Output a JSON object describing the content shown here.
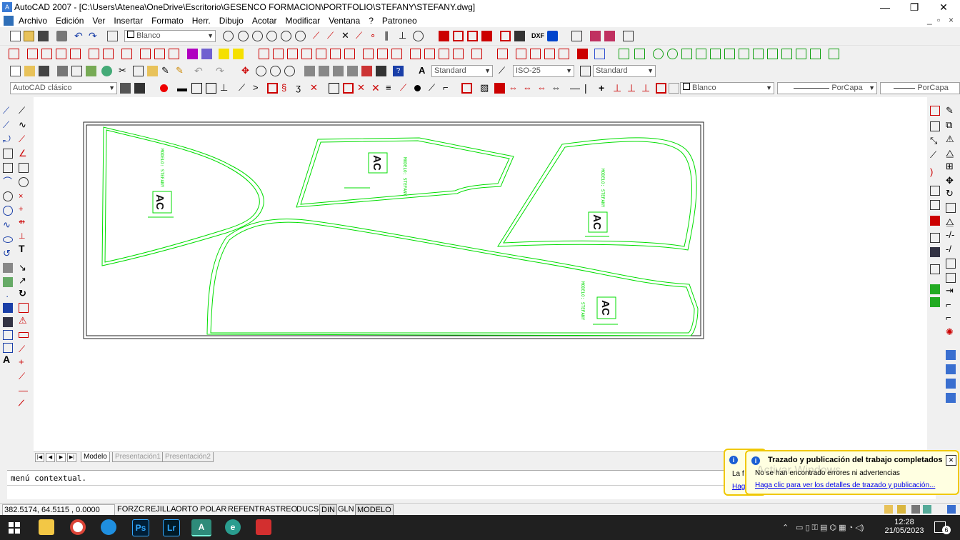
{
  "window": {
    "app_icon_label": "A",
    "title": "AutoCAD 2007 - [C:\\Users\\Atenea\\OneDrive\\Escritorio\\GESENCO FORMACION\\PORTFOLIO\\STEFANY\\STEFANY.dwg]",
    "minimize": "—",
    "maximize": "❐",
    "close": "✕"
  },
  "menubar": {
    "items": [
      "Archivo",
      "Edición",
      "Ver",
      "Insertar",
      "Formato",
      "Herr.",
      "Dibujo",
      "Acotar",
      "Modificar",
      "Ventana",
      "?",
      "Patroneo"
    ],
    "mdi_min": "_",
    "mdi_restore": "▫",
    "mdi_close": "×"
  },
  "toolbar1": {
    "layer_combo": "Blanco"
  },
  "toolbar3": {
    "text_style": "Standard",
    "dim_style": "ISO-25",
    "table_style": "Standard"
  },
  "toolbar4": {
    "workspace": "AutoCAD clásico",
    "color": "Blanco",
    "linetype": "PorCapa",
    "lineweight": "PorCapa"
  },
  "side_text_tool": "T",
  "side_mtext_tool": "A",
  "drawing": {
    "stroke_color": "#00dd00",
    "piece_labels": [
      "MODELO: STEFANY",
      "MODELO: STEFANY",
      "MODELO: STEFANY",
      "MODELO: STEFANY"
    ],
    "logo_text": "AC"
  },
  "tabs": {
    "nav": [
      "|◀",
      "◀",
      "▶",
      "▶|"
    ],
    "items": [
      "Modelo",
      "Presentación1",
      "Presentación2"
    ]
  },
  "command": {
    "text": "menú contextual."
  },
  "statusbar": {
    "coords": "382.5174, 64.5115 , 0.0000",
    "buttons": [
      "FORZC",
      "REJILLA",
      "ORTO",
      "POLAR",
      "REFENT",
      "RASTREO",
      "DUCS",
      "DIN",
      "GLN",
      "MODELO"
    ],
    "active_buttons": [
      "DIN",
      "MODELO"
    ]
  },
  "notification": {
    "title": "Trazado y publicación del trabajo completados",
    "message": "No se han encontrado errores ni advertencias",
    "link": "Haga clic para ver los detalles de trazado y publicación...",
    "close": "✕",
    "behind_line1": "La f",
    "behind_line2": "Haga",
    "watermark": "Activar Windows"
  },
  "taskbar": {
    "apps": [
      "Explorador",
      "Chrome",
      "Edge",
      "Ps",
      "Lr",
      "A",
      "e",
      "PDF"
    ],
    "time": "12:28",
    "date": "21/05/2023",
    "notifications": "6"
  }
}
